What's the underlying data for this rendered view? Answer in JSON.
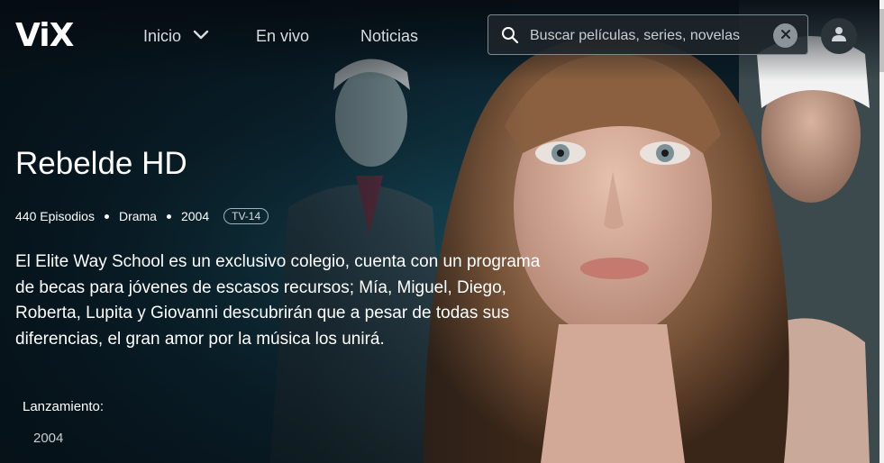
{
  "header": {
    "logo": "ViX",
    "nav": [
      {
        "label": "Inicio"
      },
      {
        "label": "En vivo"
      },
      {
        "label": "Noticias"
      }
    ],
    "search": {
      "placeholder": "Buscar películas, series, novelas",
      "value": ""
    }
  },
  "show": {
    "title": "Rebelde HD",
    "episodes": "440 Episodios",
    "genre": "Drama",
    "year": "2004",
    "rating": "TV-14",
    "description": "El Elite Way School es un exclusivo colegio, cuenta con un programa de becas para jóvenes de escasos recursos; Mía, Miguel, Diego, Roberta, Lupita y Giovanni descubrirán que a pesar de todas sus diferencias, el gran amor por la música los unirá.",
    "launch_label": "Lanzamiento:",
    "launch_value": "2004"
  },
  "icons": {
    "search": "search-icon",
    "clear": "close-icon",
    "user": "user-icon",
    "dropdown": "chevron-down-icon"
  },
  "colors": {
    "background": "#0b1a24",
    "text": "#ffffff",
    "muted": "#c9ced2"
  }
}
